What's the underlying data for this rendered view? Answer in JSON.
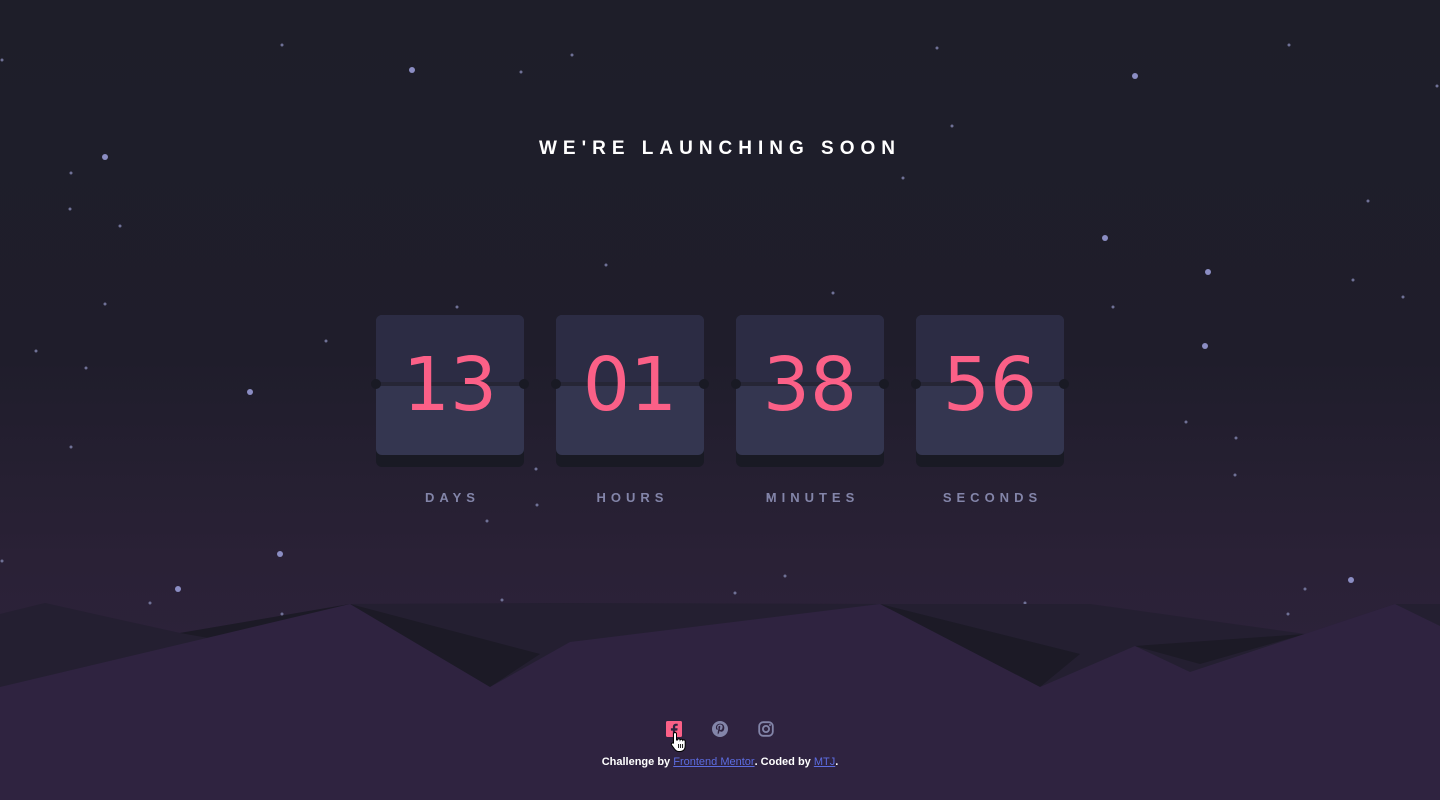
{
  "heading": "WE'RE LAUNCHING SOON",
  "countdown": [
    {
      "value": "13",
      "label": "DAYS"
    },
    {
      "value": "01",
      "label": "HOURS"
    },
    {
      "value": "38",
      "label": "MINUTES"
    },
    {
      "value": "56",
      "label": "SECONDS"
    }
  ],
  "social": {
    "icons": [
      "facebook-icon",
      "pinterest-icon",
      "instagram-icon"
    ],
    "active_color": "#fb6087",
    "color": "#8385a9"
  },
  "attribution": {
    "prefix": "Challenge by ",
    "link1": "Frontend Mentor",
    "middle": ". Coded by ",
    "link2": "MTJ",
    "suffix": "."
  },
  "colors": {
    "accent": "#fb6087",
    "card": "#343650",
    "label": "#8385a9"
  }
}
